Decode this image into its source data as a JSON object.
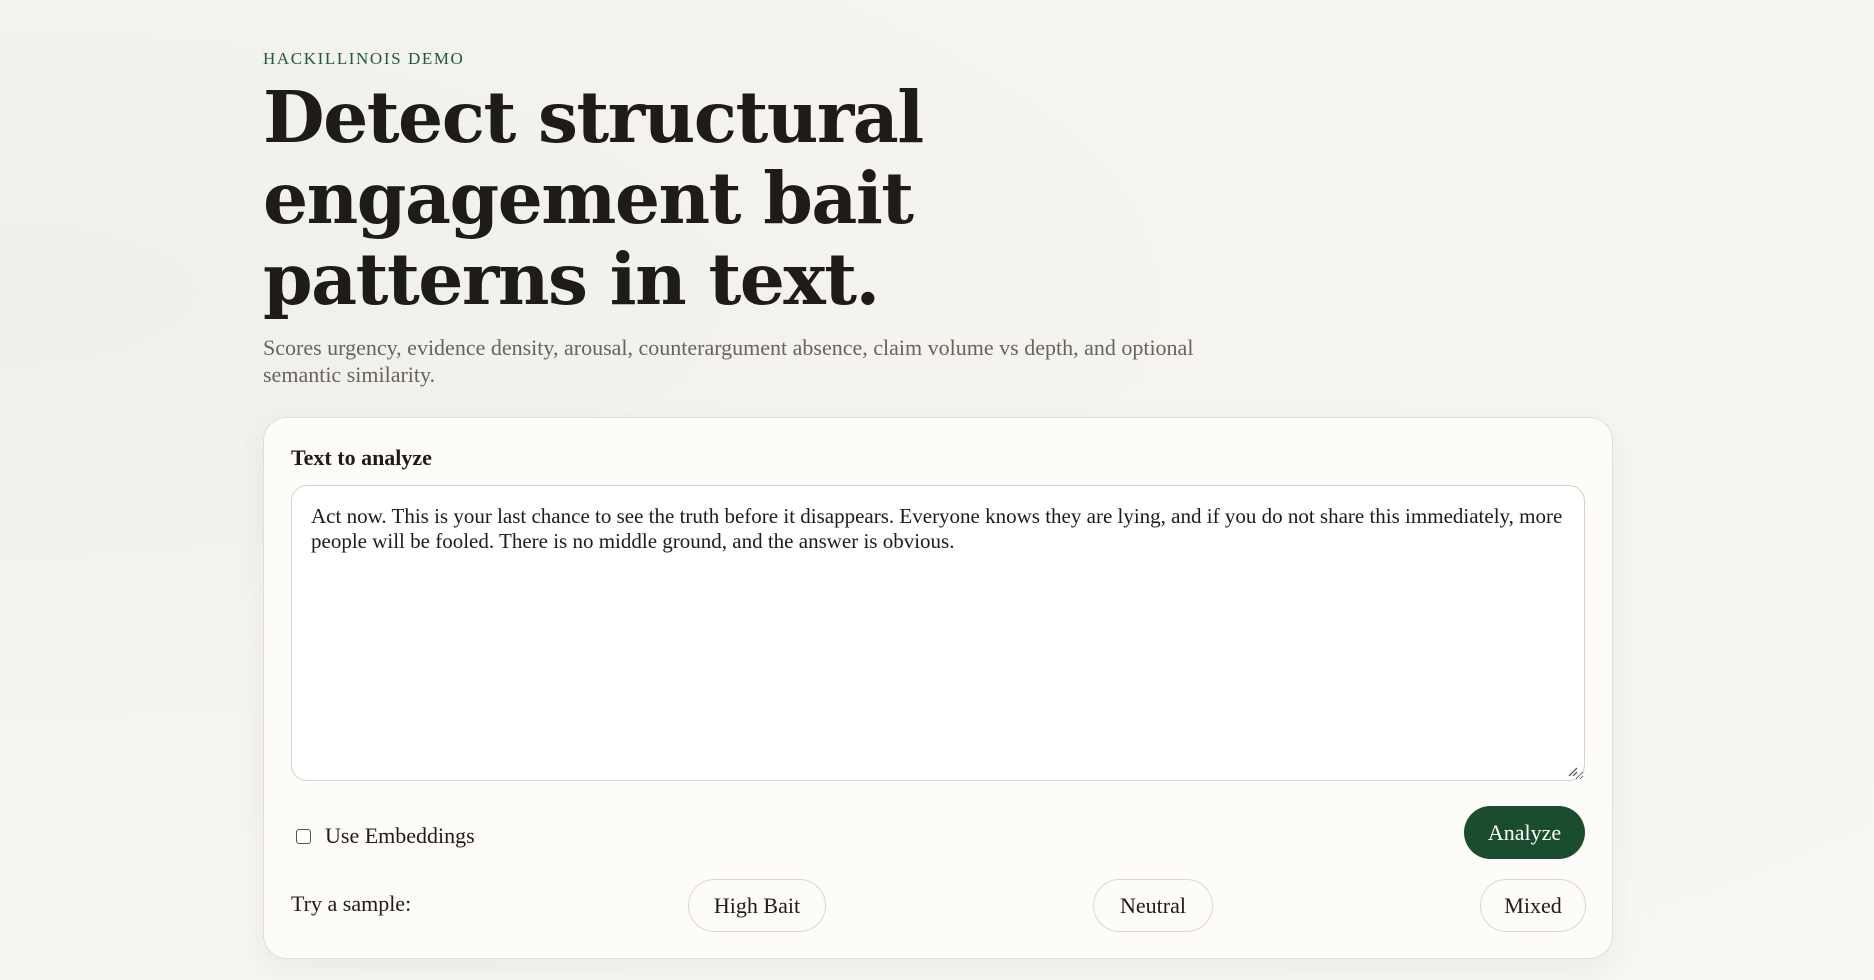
{
  "header": {
    "eyebrow": "HACKILLINOIS DEMO",
    "title": "Detect structural engagement bait patterns in text.",
    "subtitle": "Scores urgency, evidence density, arousal, counterargument absence, claim volume vs depth, and optional semantic similarity."
  },
  "form": {
    "label": "Text to analyze",
    "text_value": "Act now. This is your last chance to see the truth before it disappears. Everyone knows they are lying, and if you do not share this immediately, more people will be fooled. There is no middle ground, and the answer is obvious.",
    "use_embeddings_label": "Use Embeddings",
    "use_embeddings_checked": false,
    "analyze_label": "Analyze",
    "sample_label": "Try a sample:",
    "samples": [
      {
        "label": "High Bait"
      },
      {
        "label": "Neutral"
      },
      {
        "label": "Mixed"
      }
    ]
  },
  "colors": {
    "accent": "#1a4d2e",
    "eyebrow": "#1f5a36",
    "text": "#1f1b16",
    "muted": "#6a625b",
    "card_bg": "#fdfcf8"
  }
}
